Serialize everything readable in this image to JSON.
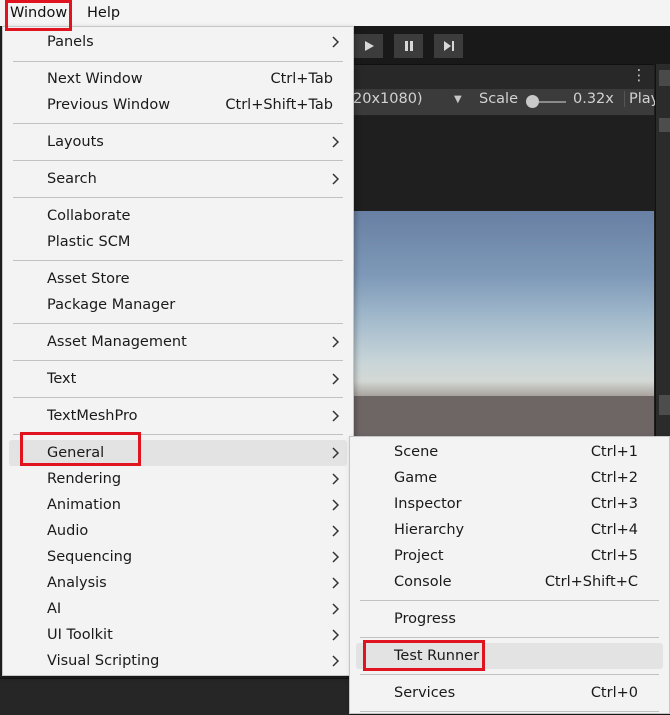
{
  "menubar": {
    "window": "Window",
    "help": "Help"
  },
  "game_view": {
    "resolution": "20x1080)",
    "scale_label": "Scale",
    "scale_value": "0.32x",
    "play_label": "Play",
    "scale_fraction": 0.0
  },
  "window_menu": {
    "panels": "Panels",
    "next_window": "Next Window",
    "next_window_sc": "Ctrl+Tab",
    "previous_window": "Previous Window",
    "previous_window_sc": "Ctrl+Shift+Tab",
    "layouts": "Layouts",
    "search": "Search",
    "collaborate": "Collaborate",
    "plastic_scm": "Plastic SCM",
    "asset_store": "Asset Store",
    "package_manager": "Package Manager",
    "asset_management": "Asset Management",
    "text": "Text",
    "textmeshpro": "TextMeshPro",
    "general": "General",
    "rendering": "Rendering",
    "animation": "Animation",
    "audio": "Audio",
    "sequencing": "Sequencing",
    "analysis": "Analysis",
    "ai": "AI",
    "ui_toolkit": "UI Toolkit",
    "visual_scripting": "Visual Scripting"
  },
  "general_submenu": {
    "scene": "Scene",
    "scene_sc": "Ctrl+1",
    "game": "Game",
    "game_sc": "Ctrl+2",
    "inspector": "Inspector",
    "inspector_sc": "Ctrl+3",
    "hierarchy": "Hierarchy",
    "hierarchy_sc": "Ctrl+4",
    "project": "Project",
    "project_sc": "Ctrl+5",
    "console": "Console",
    "console_sc": "Ctrl+Shift+C",
    "progress": "Progress",
    "test_runner": "Test Runner",
    "services": "Services",
    "services_sc": "Ctrl+0"
  },
  "colors": {
    "highlight_box": "#e0141e",
    "menu_bg": "#f3f3f3",
    "menu_hover": "#e3e3e3"
  },
  "icons": {
    "submenu": "chevron-right-icon",
    "play": "play-icon",
    "pause": "pause-icon",
    "step": "step-icon",
    "more": "kebab-icon"
  }
}
